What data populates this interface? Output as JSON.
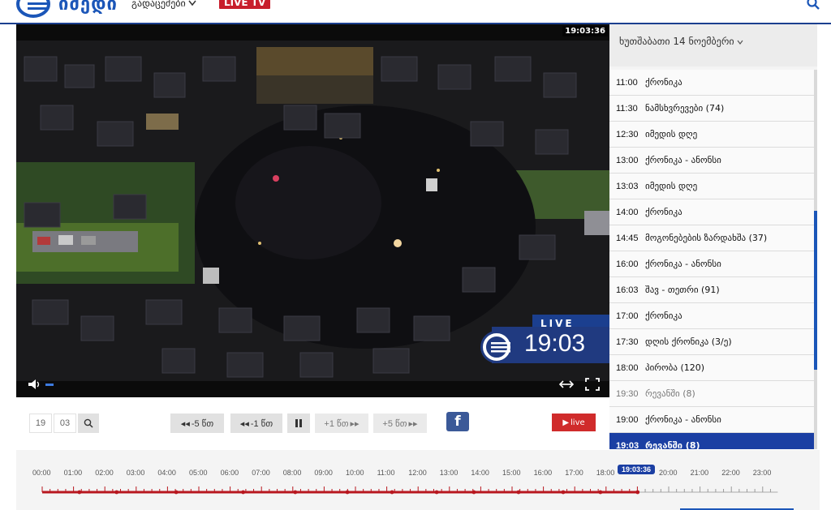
{
  "header": {
    "logo_text": "იმედი",
    "menu_label": "გადაცემები",
    "live_tv": "LIVE TV",
    "search_icon": "search-icon"
  },
  "player": {
    "timestamp": "19:03:36",
    "overlay": {
      "live": "LIVE",
      "time": "19:03"
    },
    "icons": [
      "volume-icon",
      "resize-icon",
      "fullscreen-icon"
    ]
  },
  "schedule": {
    "date": "ხუთშაბათი 14 ნოემბერი",
    "items": [
      {
        "time": "11:00",
        "name": "ქრონიკა",
        "state": "normal"
      },
      {
        "time": "11:30",
        "name": "ნამსხვრევები (74)",
        "state": "normal"
      },
      {
        "time": "12:30",
        "name": "იმედის დღე",
        "state": "normal"
      },
      {
        "time": "13:00",
        "name": "ქრონიკა - ანონსი",
        "state": "normal"
      },
      {
        "time": "13:03",
        "name": "იმედის დღე",
        "state": "normal"
      },
      {
        "time": "14:00",
        "name": "ქრონიკა",
        "state": "normal"
      },
      {
        "time": "14:45",
        "name": "მოგონებების ზარდახშა (37)",
        "state": "normal"
      },
      {
        "time": "16:00",
        "name": "ქრონიკა - ანონსი",
        "state": "normal"
      },
      {
        "time": "16:03",
        "name": "შავ - თეთრი (91)",
        "state": "normal"
      },
      {
        "time": "17:00",
        "name": "ქრონიკა",
        "state": "normal"
      },
      {
        "time": "17:30",
        "name": "დღის ქრონიკა (3/ე)",
        "state": "normal"
      },
      {
        "time": "18:00",
        "name": "პირობა (120)",
        "state": "normal"
      },
      {
        "time": "19:30",
        "name": "რევანში (8)",
        "state": "past"
      },
      {
        "time": "19:00",
        "name": "ქრონიკა - ანონსი",
        "state": "normal"
      },
      {
        "time": "19:03",
        "name": "რევანში (8)",
        "state": "active"
      }
    ]
  },
  "controls": {
    "hour": "19",
    "minute": "03",
    "back5": "-5 წთ",
    "back1": "-1 წთ",
    "fwd1": "+1 წთ",
    "fwd5": "+5 წთ",
    "facebook": "f",
    "live": "live"
  },
  "timeline": {
    "hours": [
      "00:00",
      "01:00",
      "02:00",
      "03:00",
      "04:00",
      "05:00",
      "06:00",
      "07:00",
      "08:00",
      "09:00",
      "10:00",
      "11:00",
      "12:00",
      "13:00",
      "14:00",
      "15:00",
      "16:00",
      "17:00",
      "18:00",
      "20:00",
      "21:00",
      "22:00",
      "23:00"
    ],
    "current": "19:03:36",
    "progress_fraction": 0.793,
    "colors": {
      "played": "#b8171f",
      "marker": "#1b3fa3",
      "accent": "#1b56b8"
    }
  }
}
